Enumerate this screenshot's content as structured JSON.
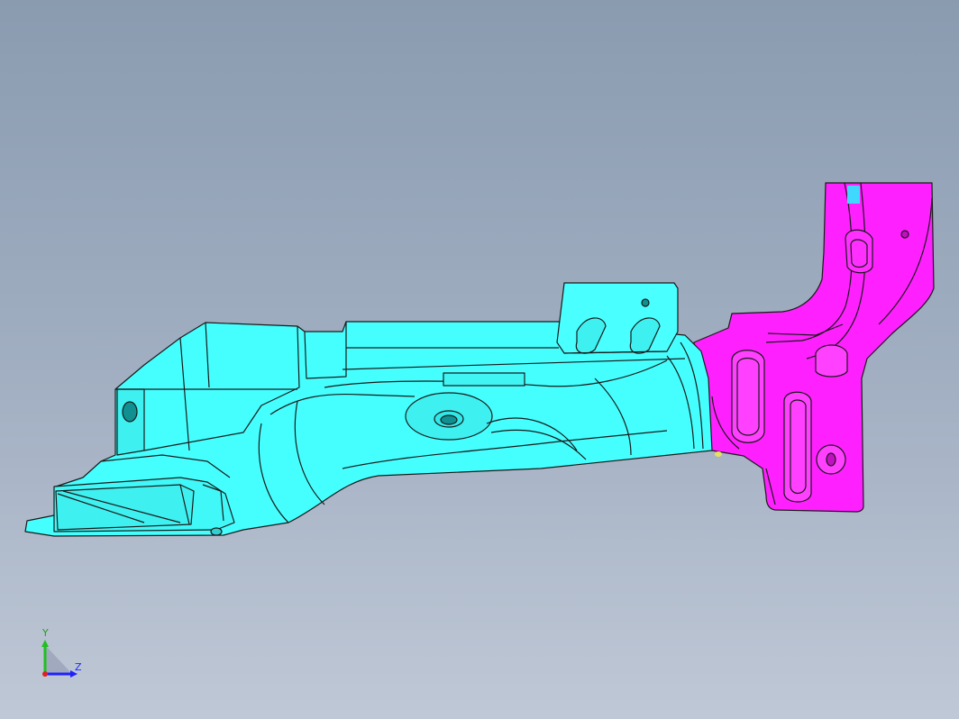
{
  "triad": {
    "y_label": "Y",
    "z_label": "Z"
  },
  "colors": {
    "part_a": "#45ffff",
    "part_b": "#ff20ff",
    "edge": "#1a1a1a",
    "background_top": "#8a9bb0",
    "background_bottom": "#bfc8d6"
  }
}
